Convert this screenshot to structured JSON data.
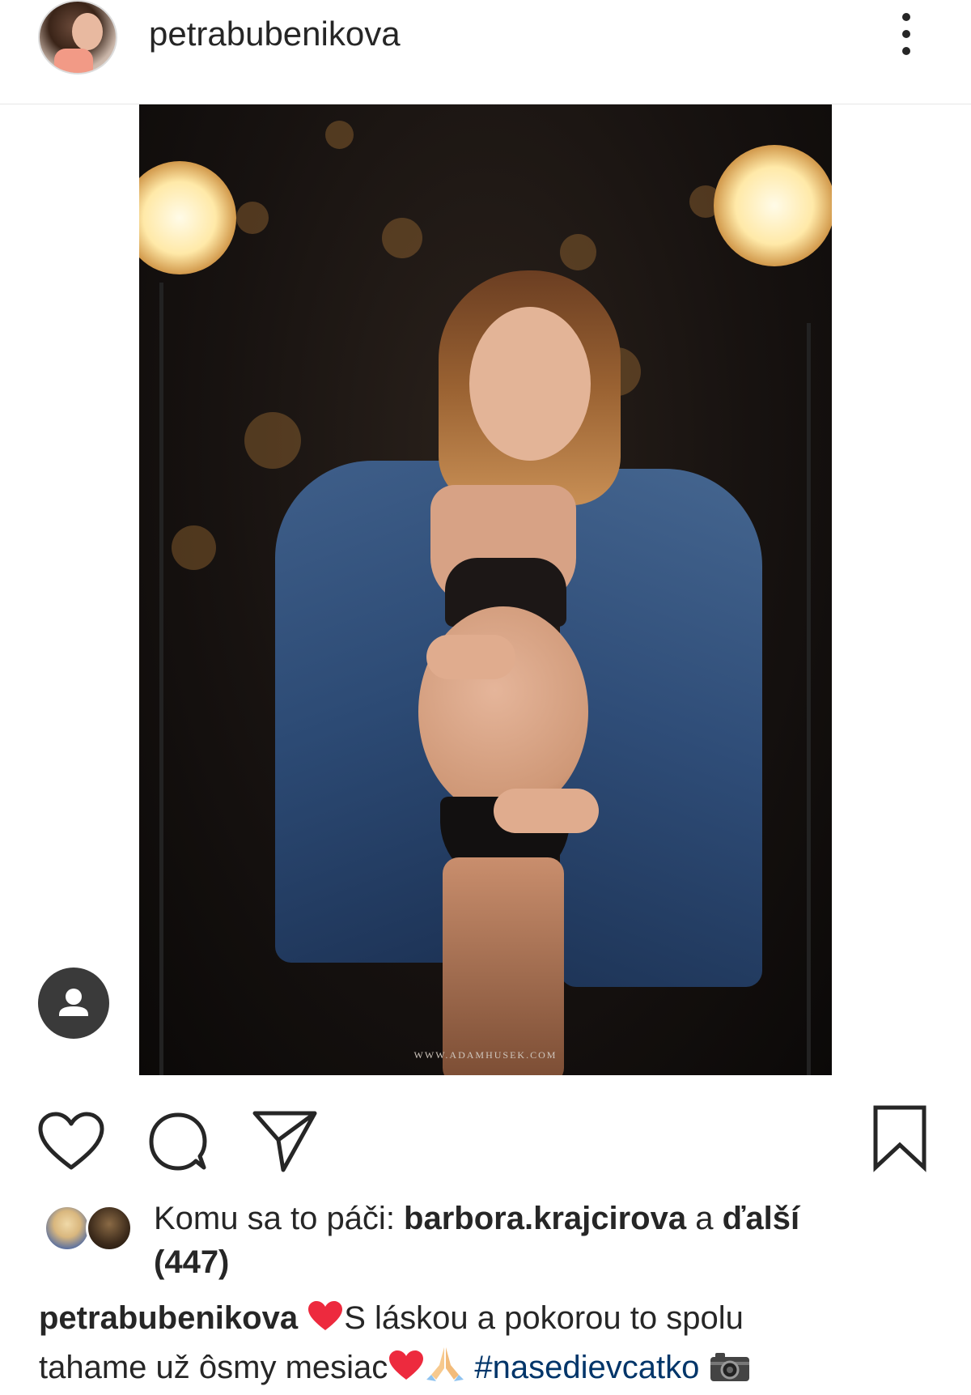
{
  "header": {
    "username": "petrabubenikova"
  },
  "photo": {
    "watermark": "WWW.ADAMHUSEK.COM"
  },
  "actions": {
    "icons": [
      "heart-icon",
      "comment-icon",
      "share-icon",
      "bookmark-icon"
    ]
  },
  "likes": {
    "prefix": "Komu sa to páči: ",
    "user": "barbora.krajcirova",
    "middle": " a ",
    "others": "ďalší",
    "count": "(447)"
  },
  "caption": {
    "username": "petrabubenikova",
    "line1": "S láskou a pokorou to spolu",
    "line2": "tahame už ôsmy mesiac",
    "hashtag": "#nasedievcatko"
  },
  "colors": {
    "text": "#262626",
    "hashtag": "#003569",
    "heart": "#ed2a3e"
  }
}
